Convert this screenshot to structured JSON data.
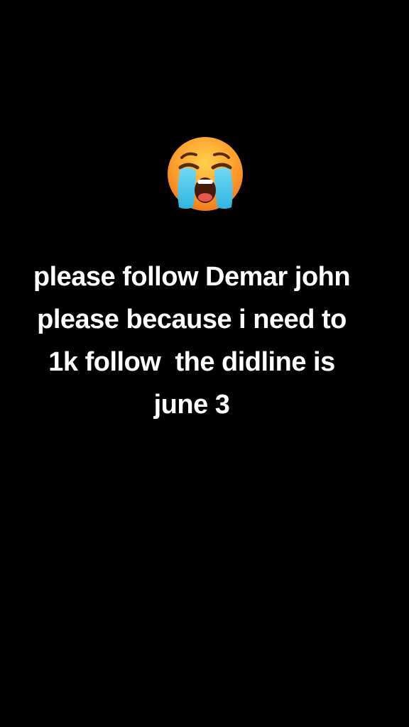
{
  "background_color": "#000000",
  "text_color": "#ffffff",
  "emoji": {
    "icon": "loudly-crying-face-icon"
  },
  "caption": {
    "lines": [
      "please follow Demar john",
      "please because i need to",
      "1k follow  the didline is",
      "june 3"
    ]
  }
}
